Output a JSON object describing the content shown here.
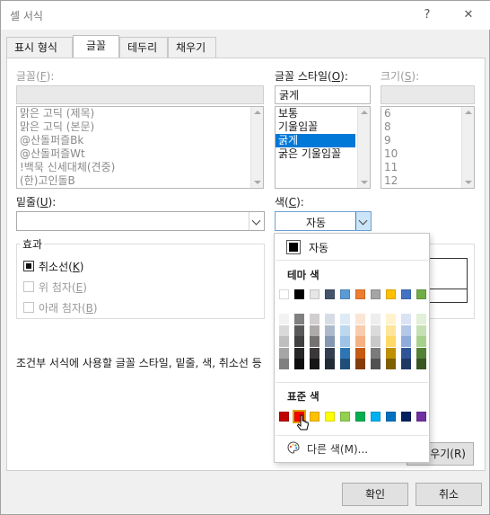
{
  "window": {
    "title": "셀 서식",
    "help": "?",
    "close": "✕"
  },
  "tabs": [
    "표시 형식",
    "글꼴",
    "테두리",
    "채우기"
  ],
  "active_tab": 1,
  "font": {
    "label": "글꼴(",
    "key": "F",
    "label_end": "):",
    "items": [
      "맑은 고딕 (제목)",
      "맑은 고딕 (본문)",
      " @산돌퍼즐Bk",
      " @산돌퍼즐Wt",
      "!백묵 신세대체(견중)",
      "(한)고인돌B"
    ]
  },
  "style": {
    "label": "글꼴 스타일(",
    "key": "O",
    "label_end": "):",
    "value": "굵게",
    "items": [
      "보통",
      "기울임꼴",
      "굵게",
      "굵은 기울임꼴"
    ],
    "selected": 2
  },
  "size": {
    "label": "크기(",
    "key": "S",
    "label_end": "):",
    "items": [
      "6",
      "8",
      "9",
      "10",
      "11",
      "12"
    ]
  },
  "underline": {
    "label": "밑줄(",
    "key": "U",
    "label_end": "):"
  },
  "color": {
    "label": "색(",
    "key": "C",
    "label_end": "):",
    "value": "자동"
  },
  "effects": {
    "title": "효과",
    "items": [
      {
        "pre": "취소선(",
        "key": "K",
        "post": ")",
        "enabled": true
      },
      {
        "pre": "위 첨자(",
        "key": "E",
        "post": ")",
        "enabled": false
      },
      {
        "pre": "아래 첨자(",
        "key": "B",
        "post": ")",
        "enabled": false
      }
    ]
  },
  "note": "조건부 서식에 사용할 글꼴 스타일, 밑줄, 색, 취소선 등",
  "clear_button_tail": "우기(R)",
  "ok": "확인",
  "cancel": "취소",
  "palette": {
    "auto": "자동",
    "theme_title": "테마 색",
    "standard_title": "표준 색",
    "more": "다른 색(M)...",
    "theme_top": [
      "#ffffff",
      "#000000",
      "#e7e6e6",
      "#44546a",
      "#5b9bd5",
      "#ed7d31",
      "#a5a5a5",
      "#ffc000",
      "#4472c4",
      "#70ad47"
    ],
    "theme_shades": [
      [
        "#f2f2f2",
        "#d9d9d9",
        "#bfbfbf",
        "#a6a6a6",
        "#808080"
      ],
      [
        "#808080",
        "#595959",
        "#404040",
        "#262626",
        "#0d0d0d"
      ],
      [
        "#d0cece",
        "#aeaaaa",
        "#757171",
        "#3a3838",
        "#171616"
      ],
      [
        "#d6dce4",
        "#acb9ca",
        "#8497b0",
        "#333f4f",
        "#222a35"
      ],
      [
        "#deebf6",
        "#bdd7ee",
        "#9dc3e6",
        "#2e75b5",
        "#1f4e79"
      ],
      [
        "#fbe5d5",
        "#f7cbac",
        "#f4b183",
        "#c55a11",
        "#843c0b"
      ],
      [
        "#ededed",
        "#dbdbdb",
        "#c9c9c9",
        "#7b7b7b",
        "#525252"
      ],
      [
        "#fff2cc",
        "#fee599",
        "#ffd966",
        "#bf9000",
        "#7f6000"
      ],
      [
        "#dae3f3",
        "#b4c7e7",
        "#8faadc",
        "#2f5597",
        "#1f3864"
      ],
      [
        "#e2efd9",
        "#c5e0b3",
        "#a8d08d",
        "#538135",
        "#375623"
      ]
    ],
    "standard": [
      "#c00000",
      "#ff0000",
      "#ffc000",
      "#ffff00",
      "#92d050",
      "#00b050",
      "#00b0f0",
      "#0070c0",
      "#002060",
      "#7030a0"
    ],
    "selected_standard": 1
  }
}
